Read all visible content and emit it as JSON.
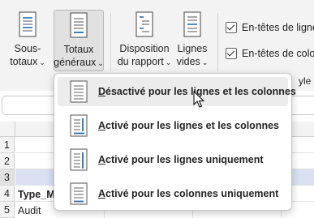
{
  "ribbon": {
    "buttons": [
      {
        "line1": "Sous-",
        "line2": "totaux",
        "chevron": "⌄"
      },
      {
        "line1": "Totaux",
        "line2": "généraux",
        "chevron": "⌄"
      },
      {
        "line1": "Disposition",
        "line2": "du rapport",
        "chevron": "⌄"
      },
      {
        "line1": "Lignes",
        "line2": "vides",
        "chevron": "⌄"
      }
    ],
    "checkboxes": [
      {
        "label": "En-têtes de lignes",
        "checked": true
      },
      {
        "label": "En-têtes de colon",
        "checked": true
      }
    ],
    "style_fragment": "yle d"
  },
  "menu": {
    "items": [
      {
        "first": "D",
        "rest": "ésactivé pour les lignes et les colonnes"
      },
      {
        "first": "A",
        "rest": "ctivé pour les lignes et les colonnes"
      },
      {
        "first": "A",
        "rest": "ctivé pour les lignes uniquement"
      },
      {
        "first": "A",
        "rest": "ctivé pour les colonnes uniquement"
      }
    ]
  },
  "grid": {
    "rows": [
      "1",
      "2",
      "3",
      "4",
      "5"
    ],
    "cells": {
      "a4": "Type_M",
      "a5": "Audit"
    }
  },
  "colors": {
    "ribbon_bg": "#f3f3f3",
    "selected_row_fill": "#d9e1f2",
    "accent_blue": "#2b6cb0",
    "text": "#242424"
  }
}
